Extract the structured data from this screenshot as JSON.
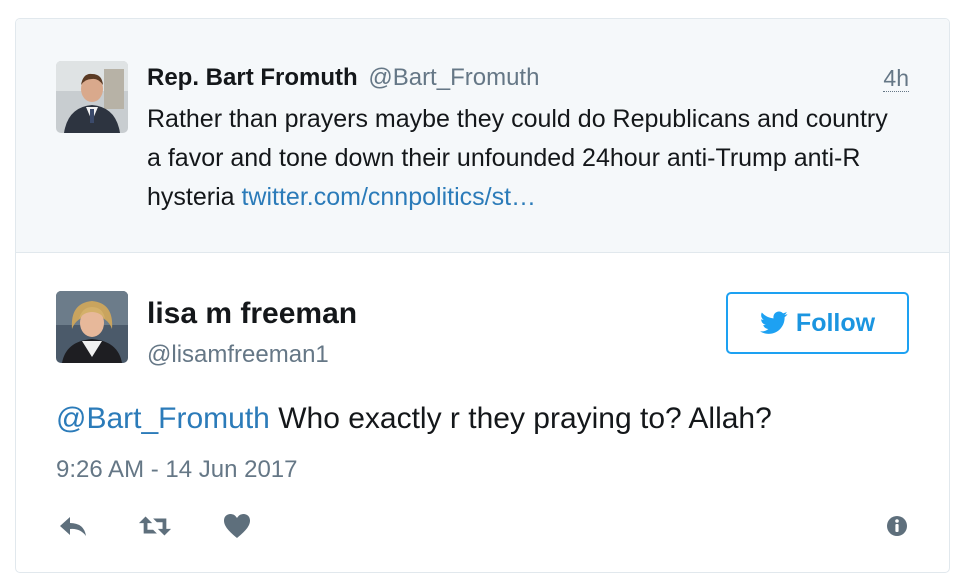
{
  "parent_tweet": {
    "author_name": "Rep. Bart Fromuth",
    "author_handle": "@Bart_Fromuth",
    "time": "4h",
    "text": "Rather than prayers maybe they could do Republicans and country a favor and tone down their unfounded 24hour anti-Trump anti-R hysteria ",
    "link": "twitter.com/cnnpolitics/st…"
  },
  "main_tweet": {
    "author_name": "lisa m freeman",
    "author_handle": "@lisamfreeman1",
    "follow_label": "Follow",
    "mention": "@Bart_Fromuth",
    "text": " Who exactly r they praying to? Allah?",
    "timestamp": "9:26 AM - 14 Jun 2017"
  },
  "icons": {
    "reply": "reply-icon",
    "retweet": "retweet-icon",
    "like": "heart-icon",
    "info": "info-icon",
    "follow": "twitter-bird-icon"
  },
  "colors": {
    "link": "#2b7bb9",
    "follow": "#1da1f2",
    "muted": "#657786",
    "icon": "#5e6f7c",
    "parent_bg": "#f5f8fa"
  }
}
